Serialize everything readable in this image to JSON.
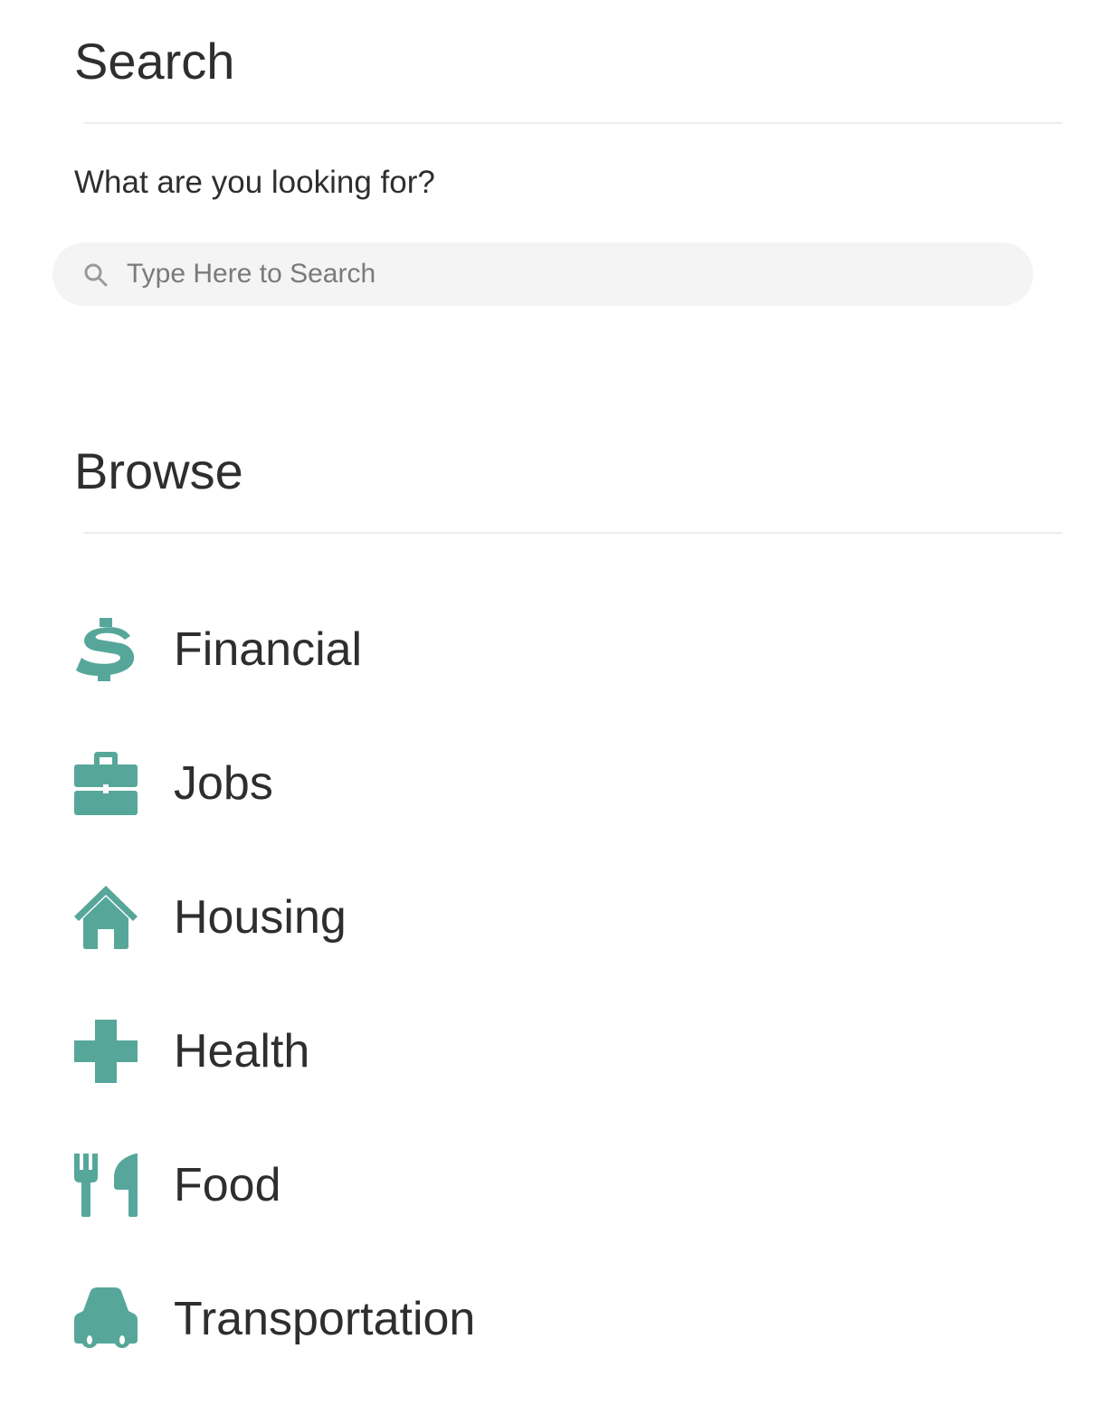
{
  "search": {
    "title": "Search",
    "prompt": "What are you looking for?",
    "placeholder": "Type Here to Search",
    "value": "",
    "icon": "search-icon"
  },
  "browse": {
    "title": "Browse",
    "categories": [
      {
        "label": "Financial",
        "icon": "dollar-icon"
      },
      {
        "label": "Jobs",
        "icon": "briefcase-icon"
      },
      {
        "label": "Housing",
        "icon": "house-icon"
      },
      {
        "label": "Health",
        "icon": "medical-cross-icon"
      },
      {
        "label": "Food",
        "icon": "fork-knife-icon"
      },
      {
        "label": "Transportation",
        "icon": "car-icon"
      }
    ]
  },
  "colors": {
    "accent": "#56a79a",
    "text": "#2e2e2e",
    "search_bg": "#f4f4f4",
    "divider": "#ececec",
    "placeholder": "#7a7a7a"
  }
}
